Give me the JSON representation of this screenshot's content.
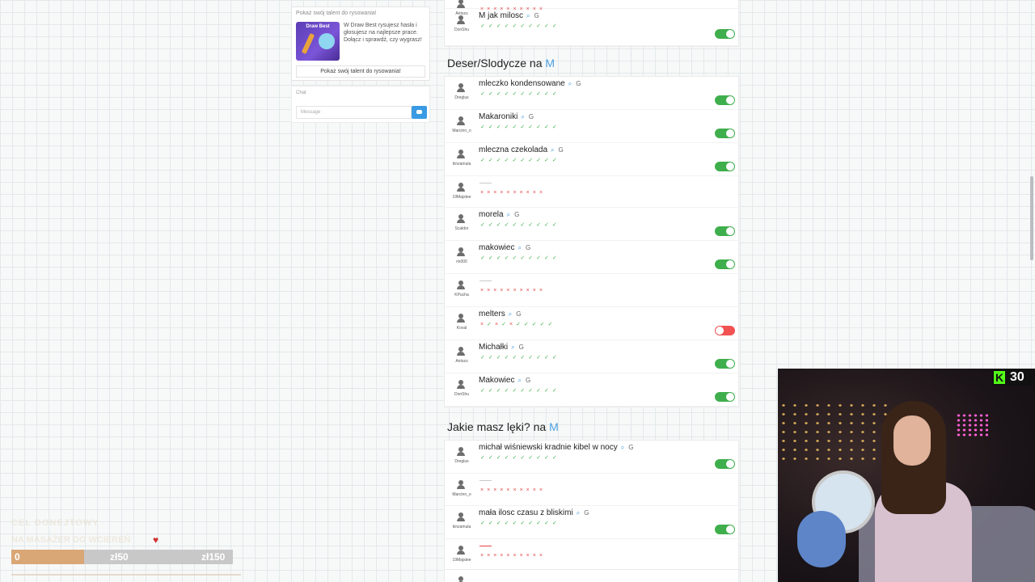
{
  "promo": {
    "header": "Pokaż swój talent do rysowania!",
    "image_label": "Draw Best",
    "text": "W Draw Best rysujesz hasła i głosujesz na najlepsze prace. Dołącz i sprawdź, czy wygrasz!",
    "button": "Pokaż swój talent do rysowania!"
  },
  "chat": {
    "title": "Chat",
    "placeholder": "Message"
  },
  "top_rows": [
    {
      "user": "Antszu",
      "answer": "",
      "votes": "xxxxxxxxxx",
      "toggle": null
    },
    {
      "user": "DonShu",
      "answer": "M jak milosc",
      "votes": "vvvvvvvvvv",
      "toggle": "on"
    }
  ],
  "sections": [
    {
      "title": "Deser/Slodycze na",
      "letter": "M",
      "rows": [
        {
          "user": "Dreglus",
          "answer": "mleczko kondensowane",
          "votes": "vvvvvvvvvv",
          "toggle": "on"
        },
        {
          "user": "Marcinn_o",
          "answer": "Makaroniki",
          "votes": "vvvvvvvvvv",
          "toggle": "on"
        },
        {
          "user": "kinzamula",
          "answer": "mleczna czekolada",
          "votes": "vvvvvvvvvv",
          "toggle": "on"
        },
        {
          "user": "19Majstee",
          "answer": "",
          "votes": "xxxxxxxxxx",
          "toggle": null
        },
        {
          "user": "Scaldor",
          "answer": "morela",
          "votes": "vvvvvvvvvv",
          "toggle": "on"
        },
        {
          "user": "rix000",
          "answer": "makowiec",
          "votes": "vvvvvvvvvv",
          "toggle": "on"
        },
        {
          "user": "KPucha",
          "answer": "",
          "votes": "xxxxxxxxxx",
          "toggle": null
        },
        {
          "user": "Koval",
          "answer": "melters",
          "votes": "xvxvxvvvvv",
          "toggle": "off"
        },
        {
          "user": "Antszu",
          "answer": "Michałki",
          "votes": "vvvvvvvvvv",
          "toggle": "on"
        },
        {
          "user": "DonShu",
          "answer": "Makowiec",
          "votes": "vvvvvvvvvv",
          "toggle": "on"
        }
      ]
    },
    {
      "title": "Jakie masz lęki? na",
      "letter": "M",
      "rows": [
        {
          "user": "Dreglus",
          "answer": "michał wiśniewski kradnie kibel w nocy",
          "votes": "vvvvvvvvvv",
          "toggle": "on"
        },
        {
          "user": "Marcinn_o",
          "answer": "",
          "votes": "xxxxxxxxxx",
          "toggle": null
        },
        {
          "user": "kinzamula",
          "answer": "mała ilosc czasu z bliskimi",
          "votes": "vvvvvvvvvv",
          "toggle": "on"
        },
        {
          "user": "19Majstee",
          "answer": "",
          "votes": "xxxxxxxxxx",
          "toggle": null,
          "red_dash": true
        }
      ]
    }
  ],
  "overlay": {
    "viewers": "30",
    "goal_title": "CEL DONEJTOWY",
    "goal_subtitle": "NA MASAŻER DO WCIEREŃ",
    "goal_current": "0",
    "goal_mid": "zł50",
    "goal_target": "zł150",
    "goal_progress": 0.33
  },
  "colors": {
    "accent": "#4a9fe0",
    "ok": "#3fb24a",
    "bad": "#e54848",
    "goal_fill": "#d9a776"
  }
}
